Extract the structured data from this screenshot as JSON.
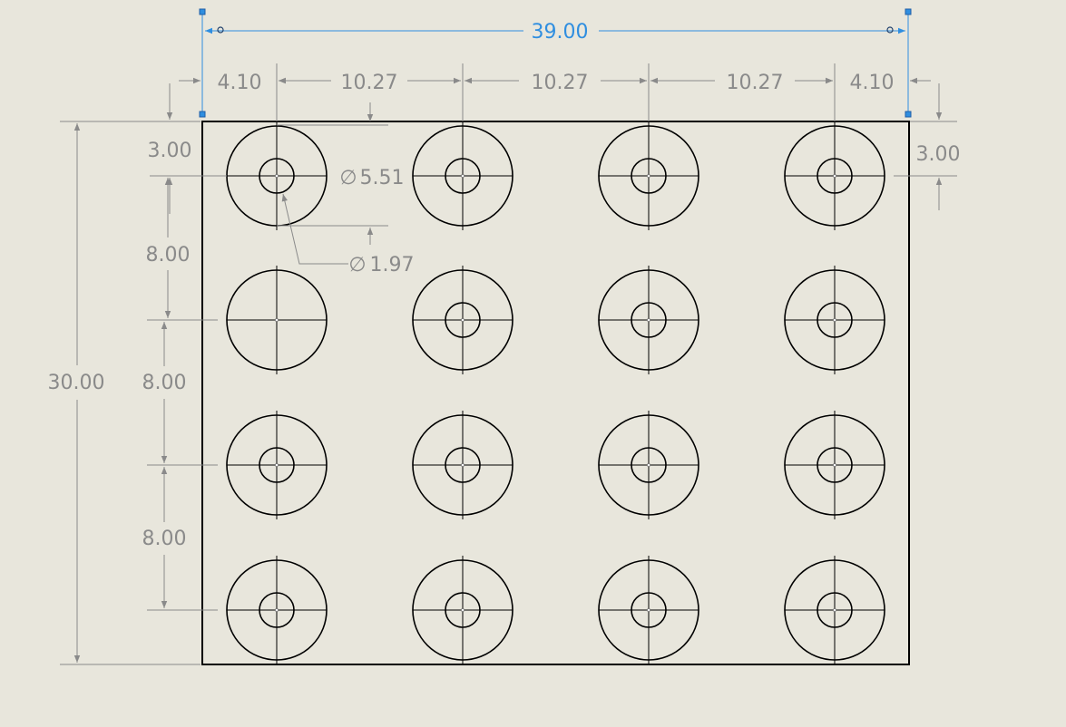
{
  "colors": {
    "background": "#e8e6dc",
    "geometry": "#000000",
    "dimension": "#8a8a8a",
    "selected_dimension": "#2f8ee0",
    "handle": "#1f5fa6"
  },
  "part": {
    "rows": 4,
    "cols": 4,
    "missing_inner_hole": {
      "row": 2,
      "col": 1
    }
  },
  "dimensions": {
    "overall_width": "39.00",
    "overall_height": "30.00",
    "left_offset": "4.10",
    "right_offset": "4.10",
    "pitch_x_1": "10.27",
    "pitch_x_2": "10.27",
    "pitch_x_3": "10.27",
    "top_offset_left": "3.00",
    "top_offset_right": "3.00",
    "pitch_y_1": "8.00",
    "pitch_y_2": "8.00",
    "pitch_y_3": "8.00",
    "outer_diameter": "5.51",
    "inner_diameter": "1.97",
    "diameter_symbol": "∅"
  }
}
